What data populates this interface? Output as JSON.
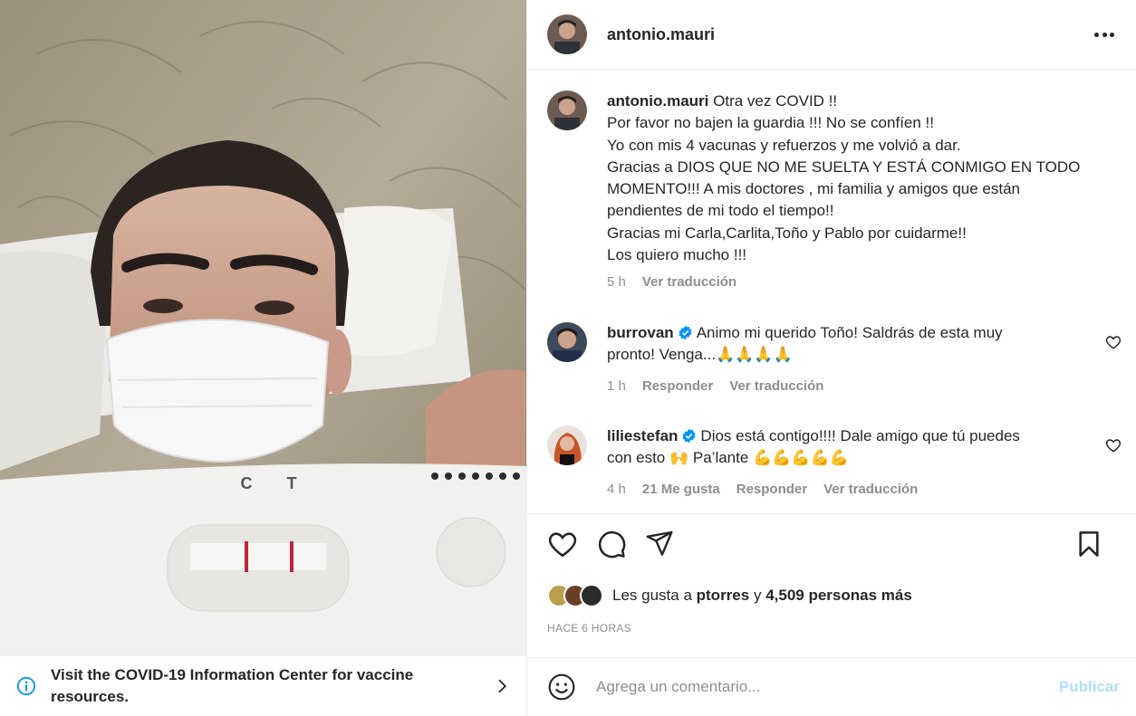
{
  "post": {
    "username": "antonio.mauri",
    "caption_lines": [
      "Otra vez COVID !!",
      "Por favor no bajen la guardia !!! No se confíen !!",
      "Yo con mis 4 vacunas y refuerzos y me volvió a dar.",
      "Gracias a DIOS QUE NO ME SUELTA Y ESTÁ CONMIGO EN TODO",
      "MOMENTO!!! A mis doctores , mi familia y amigos que están",
      "pendientes de mi todo el tiempo!!",
      "Gracias mi Carla,Carlita,Toño y Pablo por cuidarme!!",
      "Los quiero mucho !!!"
    ],
    "caption_time": "5 h",
    "see_translation": "Ver traducción"
  },
  "comments": [
    {
      "username": "burrovan",
      "verified": true,
      "text_line1": "Animo mi querido Toño! Saldrás de esta muy",
      "text_line2": "pronto! Venga...🙏🙏🙏🙏",
      "time": "1 h",
      "reply": "Responder",
      "translate": "Ver traducción"
    },
    {
      "username": "liliestefan",
      "verified": true,
      "text_line1": "Dios está contigo!!!! Dale amigo que tú puedes",
      "text_line2": "con esto 🙌 Pa’lante 💪💪💪💪💪",
      "time": "4 h",
      "likes": "21 Me gusta",
      "reply": "Responder",
      "translate": "Ver traducción"
    }
  ],
  "likes_summary": {
    "prefix": "Les gusta a",
    "user": "ptorres",
    "conj": "y",
    "others": "4,509 personas más"
  },
  "posted_ago": "HACE 6 HORAS",
  "composer": {
    "placeholder": "Agrega un comentario...",
    "post_label": "Publicar"
  },
  "banner": {
    "text": "Visit the COVID-19 Information Center for vaccine resources."
  },
  "media_test_labels": [
    "C",
    "T"
  ],
  "icons": [
    "more-options-icon",
    "heart-icon",
    "comment-icon",
    "share-icon",
    "save-icon",
    "emoji-icon",
    "info-icon",
    "chevron-right-icon",
    "verified-badge-icon"
  ]
}
